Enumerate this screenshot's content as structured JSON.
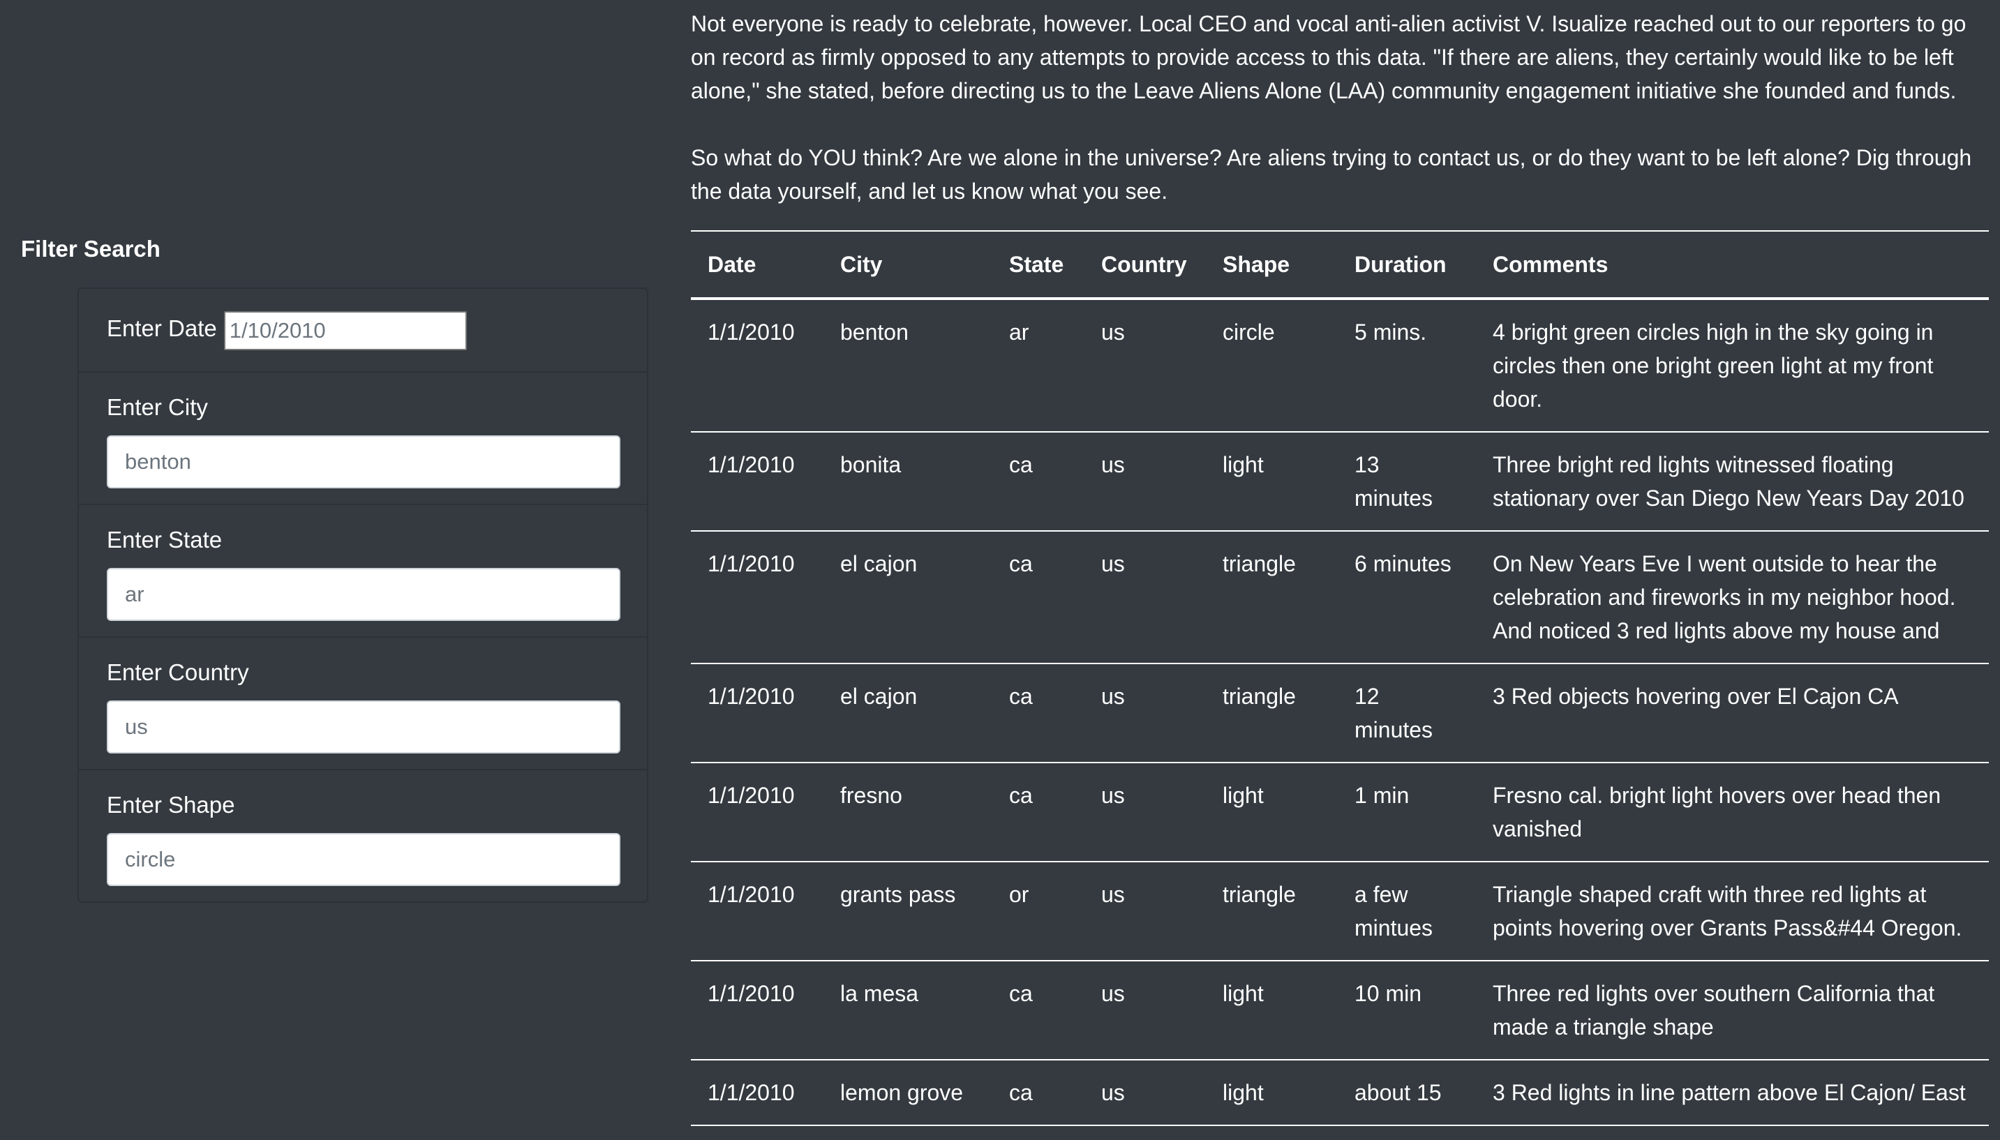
{
  "filter": {
    "title": "Filter Search",
    "date": {
      "label": "Enter Date",
      "placeholder": "1/10/2010"
    },
    "city": {
      "label": "Enter City",
      "placeholder": "benton"
    },
    "state": {
      "label": "Enter State",
      "placeholder": "ar"
    },
    "country": {
      "label": "Enter Country",
      "placeholder": "us"
    },
    "shape": {
      "label": "Enter Shape",
      "placeholder": "circle"
    }
  },
  "article": {
    "paragraphs": [
      "Not everyone is ready to celebrate, however. Local CEO and vocal anti-alien activist V. Isualize reached out to our reporters to go on record as firmly opposed to any attempts to provide access to this data. \"If there are aliens, they certainly would like to be left alone,\" she stated, before directing us to the Leave Aliens Alone (LAA) community engagement initiative she founded and funds.",
      "So what do YOU think? Are we alone in the universe? Are aliens trying to contact us, or do they want to be left alone? Dig through the data yourself, and let us know what you see."
    ]
  },
  "table": {
    "headers": [
      "Date",
      "City",
      "State",
      "Country",
      "Shape",
      "Duration",
      "Comments"
    ],
    "rows": [
      [
        "1/1/2010",
        "benton",
        "ar",
        "us",
        "circle",
        "5 mins.",
        "4 bright green circles high in the sky going in circles then one bright green light at my front door."
      ],
      [
        "1/1/2010",
        "bonita",
        "ca",
        "us",
        "light",
        "13 minutes",
        "Three bright red lights witnessed floating stationary over San Diego New Years Day 2010"
      ],
      [
        "1/1/2010",
        "el cajon",
        "ca",
        "us",
        "triangle",
        "6 minutes",
        "On New Years Eve I went outside to hear the celebration and fireworks in my neighbor hood. And noticed 3 red lights above my house and"
      ],
      [
        "1/1/2010",
        "el cajon",
        "ca",
        "us",
        "triangle",
        "12 minutes",
        "3 Red objects hovering over El Cajon CA"
      ],
      [
        "1/1/2010",
        "fresno",
        "ca",
        "us",
        "light",
        "1 min",
        "Fresno cal. bright light hovers over head then vanished"
      ],
      [
        "1/1/2010",
        "grants pass",
        "or",
        "us",
        "triangle",
        "a few mintues",
        "Triangle shaped craft with three red lights at points hovering over Grants Pass&#44 Oregon."
      ],
      [
        "1/1/2010",
        "la mesa",
        "ca",
        "us",
        "light",
        "10 min",
        "Three red lights over southern California that made a triangle shape"
      ],
      [
        "1/1/2010",
        "lemon grove",
        "ca",
        "us",
        "light",
        "about 15",
        "3 Red lights in line pattern above El Cajon/ East"
      ]
    ]
  }
}
